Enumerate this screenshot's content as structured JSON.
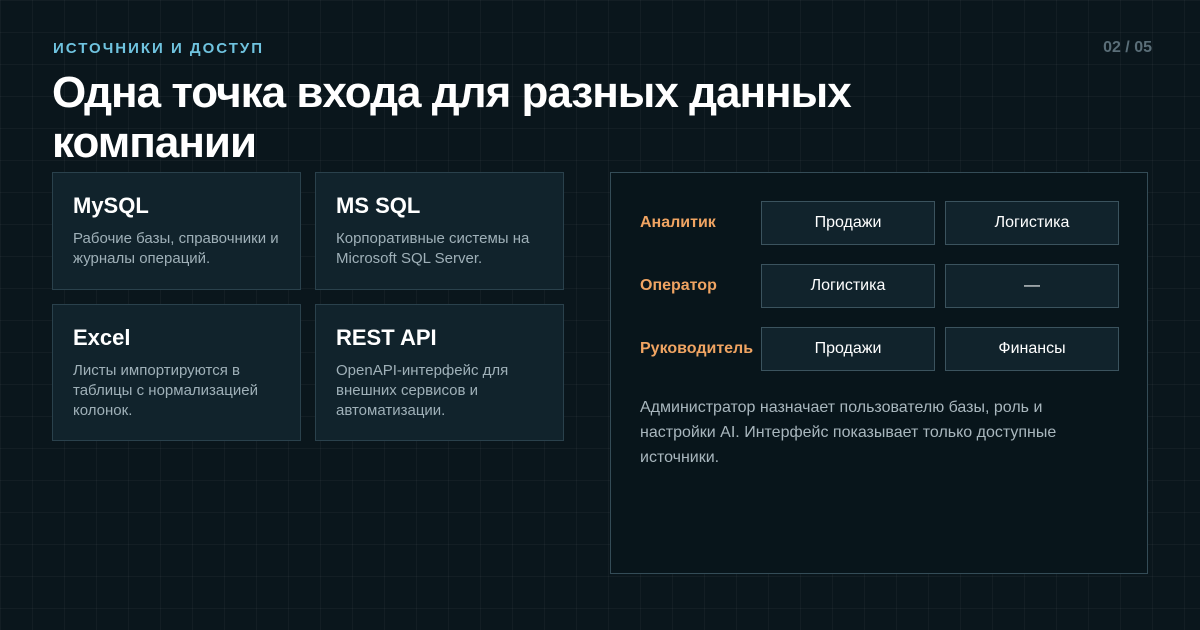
{
  "header": {
    "eyebrow": "ИСТОЧНИКИ И ДОСТУП",
    "page": "02 / 05",
    "title": "Одна точка входа для разных данных компании"
  },
  "sources": [
    {
      "name": "MySQL",
      "desc": "Рабочие базы, справочники и журналы операций."
    },
    {
      "name": "MS SQL",
      "desc": "Корпоративные системы на Microsoft SQL Server."
    },
    {
      "name": "Excel",
      "desc": "Листы импортируются в таблицы с нормализацией колонок."
    },
    {
      "name": "REST API",
      "desc": "OpenAPI-интерфейс для внешних сервисов и автоматизации."
    }
  ],
  "access": {
    "roles": [
      {
        "role": "Аналитик",
        "scopes": [
          "Продажи",
          "Логистика"
        ]
      },
      {
        "role": "Оператор",
        "scopes": [
          "Логистика",
          "—"
        ]
      },
      {
        "role": "Руководитель",
        "scopes": [
          "Продажи",
          "Финансы"
        ]
      }
    ],
    "note": "Администратор назначает пользователю базы, роль и настройки AI. Интерфейс показывает только доступные источники."
  },
  "colors": {
    "accent_eyebrow": "#6fc3df",
    "accent_role": "#f0a462",
    "background": "#0a161c"
  }
}
